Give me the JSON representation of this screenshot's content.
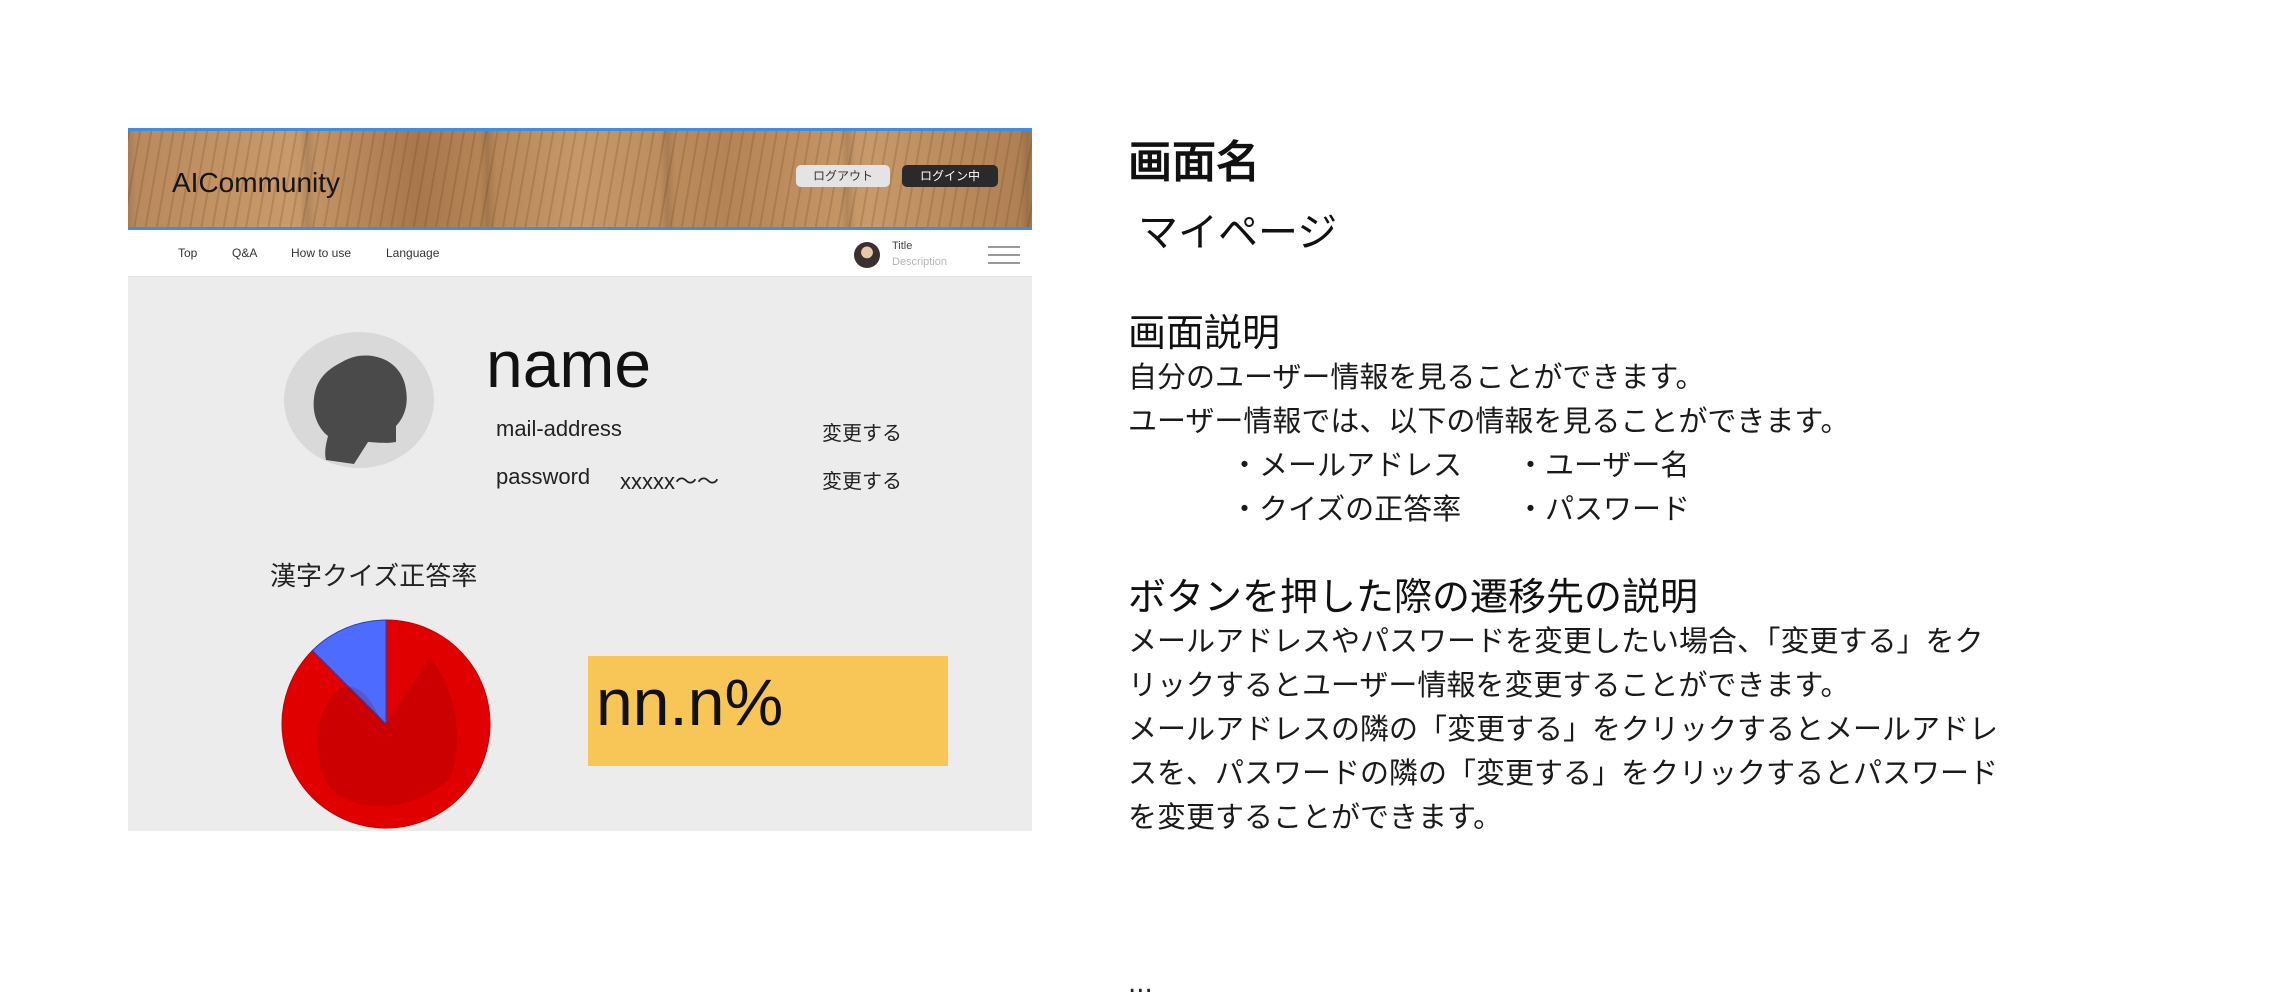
{
  "mock": {
    "brand": "AICommunity",
    "header_buttons": {
      "logout": "ログアウト",
      "login": "ログイン中"
    },
    "nav": [
      "Top",
      "Q&A",
      "How to use",
      "Language"
    ],
    "user_card": {
      "title": "Title",
      "description": "Description"
    },
    "profile": {
      "name": "name",
      "mail_label": "mail-address",
      "password_label": "password",
      "password_value": "xxxxx〜〜",
      "change_label": "変更する"
    },
    "quiz": {
      "title": "漢字クイズ正答率",
      "rate": "nn.n%"
    },
    "colors": {
      "pie_main": "#e00000",
      "pie_slice": "#4d6bff",
      "rate_box": "#f8c557",
      "header_border": "#3a8ee6"
    }
  },
  "chart_data": {
    "type": "pie",
    "slices": [
      {
        "value": 0.875,
        "color": "#e00000"
      },
      {
        "value": 0.125,
        "color": "#4d6bff"
      }
    ]
  },
  "doc": {
    "heading": "画面名",
    "screen_name": "マイページ",
    "desc_title": "画面説明",
    "desc_lines": [
      "自分のユーザー情報を見ることができます。",
      "ユーザー情報では、以下の情報を見ることができます。"
    ],
    "bullets": [
      "・メールアドレス",
      "・ユーザー名",
      "・クイズの正答率",
      "・パスワード"
    ],
    "nav_title": "ボタンを押した際の遷移先の説明",
    "nav_lines": [
      "メールアドレスやパスワードを変更したい場合、「変更する」をク",
      "リックするとユーザー情報を変更することができます。",
      "メールアドレスの隣の「変更する」をクリックするとメールアドレ",
      "スを、パスワードの隣の「変更する」をクリックするとパスワード",
      "を変更することができます。"
    ],
    "ellipsis": "..."
  }
}
